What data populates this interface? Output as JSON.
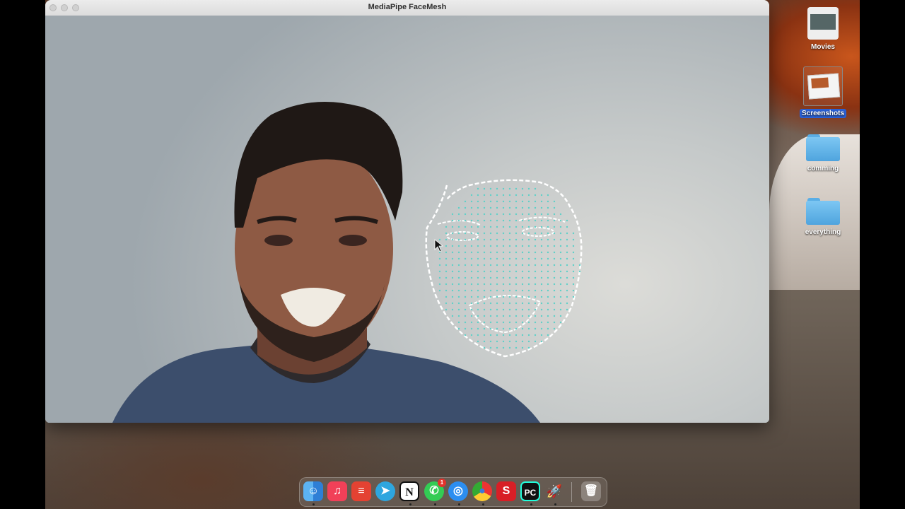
{
  "window": {
    "title": "MediaPipe FaceMesh"
  },
  "desktop_icons": [
    {
      "label": "Movies",
      "icon": "movies-folder-icon",
      "selected": false
    },
    {
      "label": "Screenshots",
      "icon": "screenshots-folder-icon",
      "selected": true
    },
    {
      "label": "comming",
      "icon": "folder-icon",
      "selected": false
    },
    {
      "label": "everything",
      "icon": "folder-icon",
      "selected": false
    }
  ],
  "dock": [
    {
      "name": "Finder",
      "icon": "finder-icon",
      "glyph": "☺"
    },
    {
      "name": "Music",
      "icon": "music-icon",
      "glyph": "♫"
    },
    {
      "name": "Todoist",
      "icon": "todoist-icon",
      "glyph": "≡"
    },
    {
      "name": "Telegram",
      "icon": "telegram-icon",
      "glyph": "➤"
    },
    {
      "name": "Notion",
      "icon": "notion-icon",
      "glyph": "N"
    },
    {
      "name": "WhatsApp",
      "icon": "whatsapp-icon",
      "glyph": "✆",
      "badge": "1"
    },
    {
      "name": "Safari",
      "icon": "safari-icon",
      "glyph": "◎"
    },
    {
      "name": "Chrome",
      "icon": "chrome-icon",
      "glyph": "●"
    },
    {
      "name": "SketchUp",
      "icon": "sketchup-icon",
      "glyph": "S"
    },
    {
      "name": "PyCharm",
      "icon": "pycharm-icon",
      "glyph": "PC"
    },
    {
      "name": "Launchpad",
      "icon": "rocket-icon",
      "glyph": "🚀"
    },
    {
      "name": "Trash",
      "icon": "trash-icon",
      "glyph": "🗑"
    }
  ],
  "colors": {
    "mesh": "#5fd0c8",
    "contour": "#ffffff",
    "selection": "#2a60d4"
  }
}
